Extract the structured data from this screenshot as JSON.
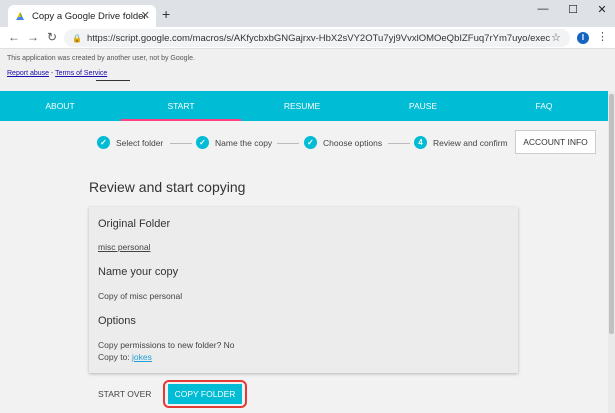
{
  "browser": {
    "tab_title": "Copy a Google Drive folder",
    "new_tab_glyph": "+",
    "tab_close_glyph": "✕",
    "minimize_glyph": "—",
    "maximize_glyph": "☐",
    "close_glyph": "✕",
    "back_glyph": "←",
    "forward_glyph": "→",
    "reload_glyph": "↻",
    "url": "https://script.google.com/macros/s/AKfycbxbGNGajrxv-HbX2sVY2OTu7yj9VvxlOMOeQbIZFuq7rYm7uyo/exec",
    "star_glyph": "☆",
    "profile_initial": "I",
    "menu_glyph": "⋮",
    "lock_glyph": "🔒"
  },
  "banner": {
    "notice": "This application was created by another user, not by Google.",
    "report_abuse": "Report abuse",
    "separator": " - ",
    "terms": "Terms of Service"
  },
  "nav": {
    "about": "ABOUT",
    "start": "START",
    "resume": "RESUME",
    "pause": "PAUSE",
    "faq": "FAQ"
  },
  "steps": {
    "s1_label": "Select folder",
    "s2_label": "Name the copy",
    "s3_label": "Choose options",
    "s4_number": "4",
    "s4_label": "Review and confirm",
    "check_glyph": "✓"
  },
  "account_info": "ACCOUNT INFO",
  "main": {
    "title": "Review and start copying",
    "original_heading": "Original Folder",
    "original_value": "misc personal",
    "name_heading": "Name your copy",
    "name_value": "Copy of misc personal",
    "options_heading": "Options",
    "permissions_text": "Copy permissions to new folder? No",
    "copy_to_label": "Copy to: ",
    "copy_to_value": "jokes"
  },
  "actions": {
    "start_over": "START OVER",
    "copy_folder": "COPY FOLDER"
  },
  "colors": {
    "accent": "#00bcd4",
    "active_tab_indicator": "#ff4081",
    "link": "#1ea0d6",
    "highlight_outline": "#e53935"
  }
}
